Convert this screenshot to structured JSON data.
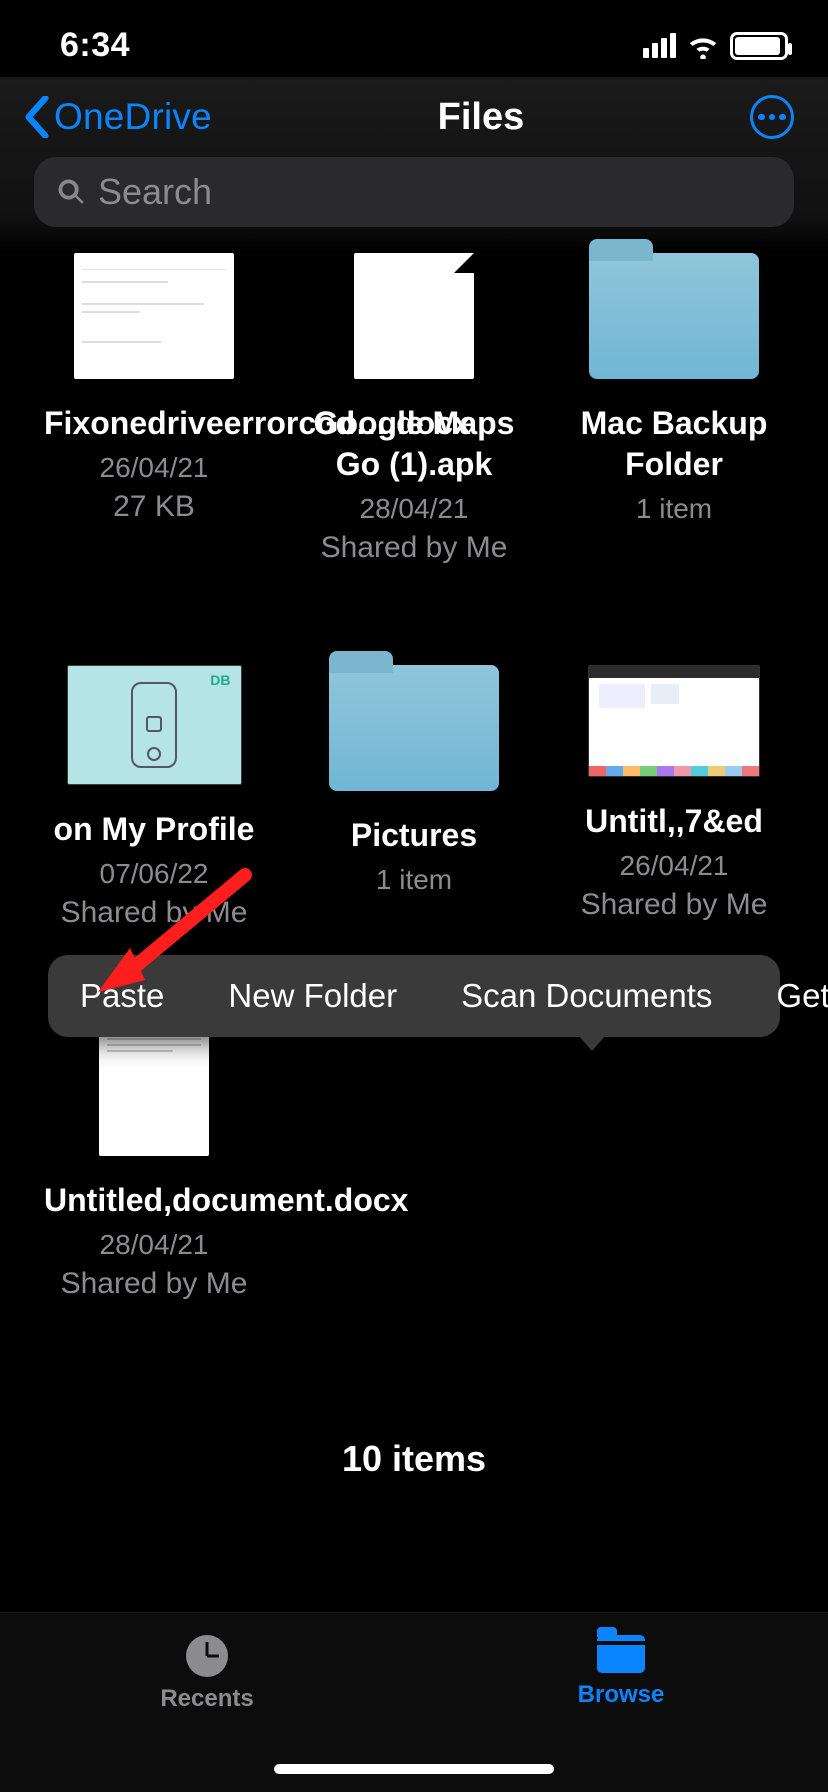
{
  "status": {
    "time": "6:34"
  },
  "nav": {
    "back_label": "OneDrive",
    "title": "Files"
  },
  "search": {
    "placeholder": "Search"
  },
  "items": [
    {
      "name": "Fixonedriveerrorcod….docx",
      "sub": "26/04/21",
      "sub2": "27 KB"
    },
    {
      "name": "Google Maps Go (1).apk",
      "sub": "28/04/21",
      "sub2": "Shared by Me"
    },
    {
      "name": "Mac Backup Folder",
      "sub": "1 item",
      "sub2": ""
    },
    {
      "name": "on My Profile",
      "sub": "07/06/22",
      "sub2": "Shared by Me"
    },
    {
      "name": "Pictures",
      "sub": "1 item",
      "sub2": ""
    },
    {
      "name": "Untitl,,7&ed",
      "sub": "26/04/21",
      "sub2": "Shared by Me"
    },
    {
      "name": "Untitled,document.docx",
      "sub": "28/04/21",
      "sub2": "Shared by Me"
    }
  ],
  "context_menu": {
    "paste": "Paste",
    "new_folder": "New Folder",
    "scan_documents": "Scan Documents",
    "get_info": "Get Info"
  },
  "footer": {
    "count": "10 items"
  },
  "tabs": {
    "recents": "Recents",
    "browse": "Browse"
  },
  "thumb_tag": "DB"
}
